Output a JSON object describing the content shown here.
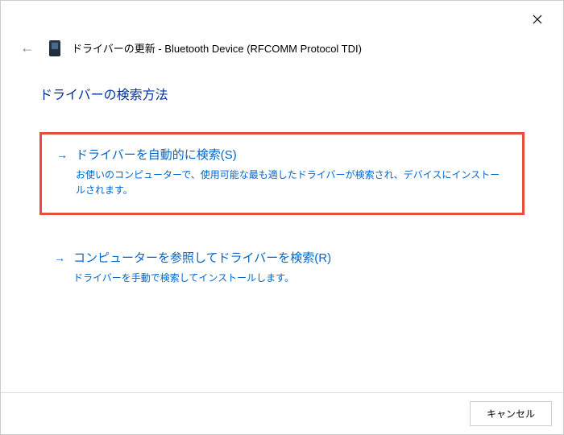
{
  "header": {
    "title_prefix": "ドライバーの更新 - ",
    "device_name": "Bluetooth Device (RFCOMM Protocol TDI)"
  },
  "main": {
    "heading": "ドライバーの検索方法",
    "options": [
      {
        "title": "ドライバーを自動的に検索(S)",
        "desc": "お使いのコンピューターで、使用可能な最も適したドライバーが検索され、デバイスにインストールされます。"
      },
      {
        "title": "コンピューターを参照してドライバーを検索(R)",
        "desc": "ドライバーを手動で検索してインストールします。"
      }
    ]
  },
  "footer": {
    "cancel_label": "キャンセル"
  }
}
